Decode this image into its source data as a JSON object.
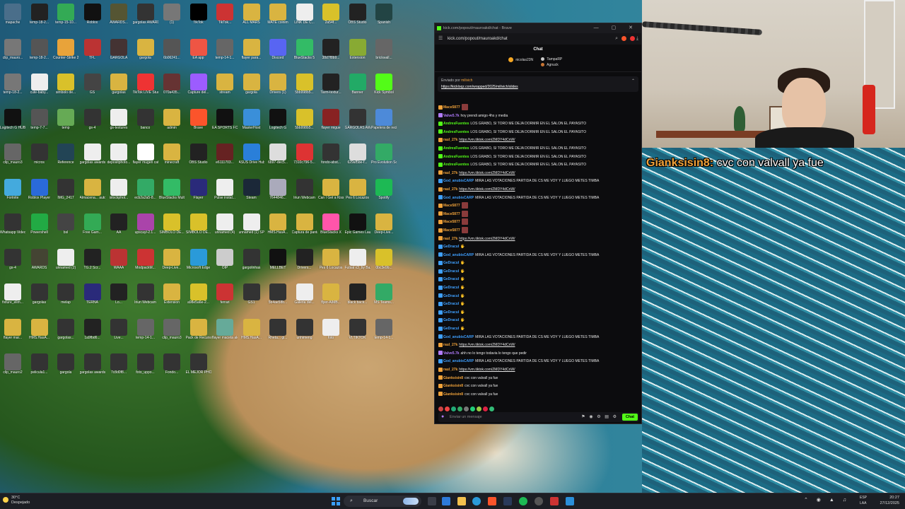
{
  "desktop": {
    "icons": [
      {
        "label": "mapache",
        "color": "#4a6e8a"
      },
      {
        "label": "temp-18-2...",
        "color": "#222"
      },
      {
        "label": "temp-15-10...",
        "color": "#3a5"
      },
      {
        "label": "Roblox",
        "color": "#111"
      },
      {
        "label": "AWARDS...",
        "color": "#553"
      },
      {
        "label": "gargolas AWARDS",
        "color": "#333"
      },
      {
        "label": "(1)",
        "color": "#777"
      },
      {
        "label": "TikTok",
        "color": "#000"
      },
      {
        "label": "TikTok...",
        "color": "#c33"
      },
      {
        "label": "ALL MARS",
        "color": "#d9b441"
      },
      {
        "label": "MATE coinim",
        "color": "#d9b441"
      },
      {
        "label": "LINK DE C...",
        "color": "#eee"
      },
      {
        "label": "2a54f...",
        "color": "#d9c12a"
      },
      {
        "label": "OBS Studio",
        "color": "#222"
      },
      {
        "label": "Spanish",
        "color": "#244"
      },
      {
        "label": "clip_mauro...",
        "color": "#777"
      },
      {
        "label": "temp-18-2...",
        "color": "#555"
      },
      {
        "label": "Counter-Strike 2",
        "color": "#e8a33a"
      },
      {
        "label": "TFL",
        "color": "#b33"
      },
      {
        "label": "GARGOLA",
        "color": "#433"
      },
      {
        "label": "gargola",
        "color": "#d9b441"
      },
      {
        "label": "6b06241...",
        "color": "#555"
      },
      {
        "label": "EA app",
        "color": "#e54"
      },
      {
        "label": "temp-14-1...",
        "color": "#666"
      },
      {
        "label": "flayer para...",
        "color": "#d9b441"
      },
      {
        "label": "Discord",
        "color": "#5865f2"
      },
      {
        "label": "BlueStacks 5",
        "color": "#3b6"
      },
      {
        "label": "38d7f8b9...",
        "color": "#222"
      },
      {
        "label": "Extension",
        "color": "#8a3"
      },
      {
        "label": "brickwall...",
        "color": "#666"
      },
      {
        "label": "temp-18-2...",
        "color": "#777"
      },
      {
        "label": "cute-baby...",
        "color": "#eee"
      },
      {
        "label": "simbolo de...",
        "color": "#d9c12a"
      },
      {
        "label": "GS",
        "color": "#444"
      },
      {
        "label": "gargolas",
        "color": "#d9b441"
      },
      {
        "label": "TikTok LIVE Studio",
        "color": "#e33"
      },
      {
        "label": "070a435...",
        "color": "#633"
      },
      {
        "label": "Capture del...",
        "color": "#9c5cff"
      },
      {
        "label": "stream",
        "color": "#d9b441"
      },
      {
        "label": "gargola",
        "color": "#d9b441"
      },
      {
        "label": "Drivers (1)",
        "color": "#d9b441"
      },
      {
        "label": "5bb998b5...",
        "color": "#d9c12a"
      },
      {
        "label": "Tarm-textur...",
        "color": "#222"
      },
      {
        "label": "Banner",
        "color": "#2a6"
      },
      {
        "label": "Kick Symbol",
        "color": "#53fc18"
      },
      {
        "label": "Logitech G HUB",
        "color": "#111"
      },
      {
        "label": "temp-7-7...",
        "color": "#555"
      },
      {
        "label": "temp",
        "color": "#6a5"
      },
      {
        "label": "gs-4",
        "color": "#333"
      },
      {
        "label": "gs-textures",
        "color": "#eee"
      },
      {
        "label": "banco",
        "color": "#333"
      },
      {
        "label": "admin",
        "color": "#d9b441"
      },
      {
        "label": "Brave",
        "color": "#fb542b"
      },
      {
        "label": "EA SPORTS FC",
        "color": "#111"
      },
      {
        "label": "MasterHost",
        "color": "#3a8fd9"
      },
      {
        "label": "Logitech G",
        "color": "#111"
      },
      {
        "label": "5bb998b5...",
        "color": "#d9c12a"
      },
      {
        "label": "flayer migue",
        "color": "#822"
      },
      {
        "label": "GARGOLAS AWARDS",
        "color": "#333"
      },
      {
        "label": "Papelera de reciclaje",
        "color": "#4d8ad9"
      },
      {
        "label": "clip_mauro3",
        "color": "#666"
      },
      {
        "label": "micros",
        "color": "#333"
      },
      {
        "label": "Reference",
        "color": "#245"
      },
      {
        "label": "gargolas awards",
        "color": "#eee"
      },
      {
        "label": "depositphoto...",
        "color": "#eee"
      },
      {
        "label": "flayer mugen caffera",
        "color": "#fff"
      },
      {
        "label": "minecraft",
        "color": "#d9b441"
      },
      {
        "label": "OBS Studio",
        "color": "#222"
      },
      {
        "label": "e6111703...",
        "color": "#622"
      },
      {
        "label": "ASUS Drive Hub",
        "color": "#2a7fd9"
      },
      {
        "label": "6b97-dec5...",
        "color": "#ddd"
      },
      {
        "label": "7310c796-5...",
        "color": "#d33"
      },
      {
        "label": "fondo-abst...",
        "color": "#333"
      },
      {
        "label": "629af5be-f...",
        "color": "#ddd"
      },
      {
        "label": "Pro Evolution Soccer 6",
        "color": "#3a6"
      },
      {
        "label": "Fortnite",
        "color": "#4ad"
      },
      {
        "label": "Roblox Player",
        "color": "#2a6ad9"
      },
      {
        "label": "IMG_2417",
        "color": "#333"
      },
      {
        "label": "Almacena... automatic...",
        "color": "#d9b441"
      },
      {
        "label": "istockphot...",
        "color": "#eee"
      },
      {
        "label": "ecb2a2a5-8...",
        "color": "#3a6"
      },
      {
        "label": "BlueStacks Multi-Insta...",
        "color": "#3b6"
      },
      {
        "label": "Flayer",
        "color": "#2a2a7a"
      },
      {
        "label": "Pulse instal...",
        "color": "#eee"
      },
      {
        "label": "Steam",
        "color": "#1b2838"
      },
      {
        "label": "7644846...",
        "color": "#aab"
      },
      {
        "label": "Iriun Webcam",
        "color": "#333"
      },
      {
        "label": "Can I Get a Kiss Mauroo",
        "color": "#d9b441"
      },
      {
        "label": "Pes 6 Locazos",
        "color": "#d9b441"
      },
      {
        "label": "Spotify",
        "color": "#1db954"
      },
      {
        "label": "Whatsapp Video 2025",
        "color": "#333"
      },
      {
        "label": "Powershell",
        "color": "#2a4"
      },
      {
        "label": "bsl",
        "color": "#444"
      },
      {
        "label": "Free Gam...",
        "color": "#3a5"
      },
      {
        "label": "AA",
        "color": "#222"
      },
      {
        "label": "upscayl-2.1...",
        "color": "#a4a"
      },
      {
        "label": "SIMBOLO DE...",
        "color": "#d9c12a"
      },
      {
        "label": "SIMBOLO DE...",
        "color": "#d9c12a"
      },
      {
        "label": "unnamed (4)",
        "color": "#eee"
      },
      {
        "label": "unnamed (1) SPOOL...",
        "color": "#eee"
      },
      {
        "label": "HMS.HasA...",
        "color": "#d9b441"
      },
      {
        "label": "Captura de pantalla ...",
        "color": "#d9b441"
      },
      {
        "label": "BlueStacks X",
        "color": "#f5a"
      },
      {
        "label": "Epic Games Launcher",
        "color": "#111"
      },
      {
        "label": "Deep-Live...",
        "color": "#d9b441"
      },
      {
        "label": "gs-4",
        "color": "#333"
      },
      {
        "label": "AWARDS",
        "color": "#443"
      },
      {
        "label": "unnamed (2)",
        "color": "#eee"
      },
      {
        "label": "TG.2 Scr...",
        "color": "#222"
      },
      {
        "label": "WAAA",
        "color": "#b33"
      },
      {
        "label": "ModpackM...",
        "color": "#c33"
      },
      {
        "label": "Deep-Live...",
        "color": "#d9b441"
      },
      {
        "label": "Microsoft Edge",
        "color": "#2a9ad9"
      },
      {
        "label": "OIP",
        "color": "#ccc"
      },
      {
        "label": "gargolinhas",
        "color": "#333"
      },
      {
        "label": "MELLBET",
        "color": "#111"
      },
      {
        "label": "Drivers...",
        "color": "#222"
      },
      {
        "label": "Pes 6 Locazos",
        "color": "#d9b441"
      },
      {
        "label": "Futsal x3_by Bazinga Fro...",
        "color": "#eee"
      },
      {
        "label": "0bc3e9b...",
        "color": "#d9c12a"
      },
      {
        "label": "fixture_elim...",
        "color": "#eee"
      },
      {
        "label": "gargolas",
        "color": "#333"
      },
      {
        "label": "melap",
        "color": "#333"
      },
      {
        "label": "TERNA",
        "color": "#2a2a7a"
      },
      {
        "label": "Lo...",
        "color": "#222"
      },
      {
        "label": "Iriun Webcam",
        "color": "#333"
      },
      {
        "label": "Extension",
        "color": "#d9b441"
      },
      {
        "label": "a98e5a6e-2...",
        "color": "#d9c12a"
      },
      {
        "label": "ferrari",
        "color": "#c33"
      },
      {
        "label": "GS1",
        "color": "#333"
      },
      {
        "label": "5b4ae58b...",
        "color": "#333"
      },
      {
        "label": "Galeria del...",
        "color": "#eee"
      },
      {
        "label": "flyer-AIMB...",
        "color": "#d9b441"
      },
      {
        "label": "black back...",
        "color": "#222"
      },
      {
        "label": "MS Teams...",
        "color": "#3a6"
      },
      {
        "label": "flayer mar...",
        "color": "#d9b441"
      },
      {
        "label": "HMS.HasA...",
        "color": "#d9b441"
      },
      {
        "label": "gargolas...",
        "color": "#333"
      },
      {
        "label": "1a9fbd6...",
        "color": "#222"
      },
      {
        "label": "Live...",
        "color": "#333"
      },
      {
        "label": "temp-14-1...",
        "color": "#666"
      },
      {
        "label": "clip_mauro3",
        "color": "#666"
      },
      {
        "label": "Pack de Recursos",
        "color": "#d9b441"
      },
      {
        "label": "flayer maceta alca canyat v kits maul...",
        "color": "#6a9"
      },
      {
        "label": "HMS.HasA...",
        "color": "#d9b441"
      },
      {
        "label": "Rheta... gi...",
        "color": "#333"
      },
      {
        "label": "unhimeng",
        "color": "#333"
      },
      {
        "label": "foto",
        "color": "#eee"
      },
      {
        "label": "VI.TIKTOK",
        "color": "#333"
      },
      {
        "label": "temp-14-1...",
        "color": "#666"
      },
      {
        "label": "clip_mauro2",
        "color": "#666"
      },
      {
        "label": "pelicula1...",
        "color": "#333"
      },
      {
        "label": "gargola",
        "color": "#333"
      },
      {
        "label": "gargolas awards",
        "color": "#333"
      },
      {
        "label": "7c8d0f8...",
        "color": "#333"
      },
      {
        "label": "foto_uppo...",
        "color": "#333"
      },
      {
        "label": "Fondo...",
        "color": "#333"
      },
      {
        "label": "EL MEJOR PHONE",
        "color": "#333"
      }
    ]
  },
  "browser": {
    "tab_title": "kick.com/popout/mauroakd/chat - Brave",
    "url": "kick.com/popout/mauroakd/chat",
    "window_controls": "— ▢ ✕"
  },
  "chat": {
    "header": "Chat",
    "leaderboard": {
      "first": {
        "name": "nicolas23N",
        "rank": "1",
        "gifts": "1"
      },
      "second": {
        "name": "TampaRP",
        "gifts": "1"
      },
      "third": {
        "name": "Agnuck",
        "gifts": "1"
      }
    },
    "pinned": {
      "sent_by_label": "Enviado por",
      "sent_by_user": "milivich",
      "link": "https://kickloqz.com/wrapped/2025/milivich/slides"
    },
    "messages": [
      {
        "user": "Mace5877",
        "color": "#f0a23a",
        "text": "",
        "emote": true,
        "link": false
      },
      {
        "user": "Valve5.7k",
        "color": "#b27cff",
        "text": "hoy prendi amigo 4hs y media",
        "emote": false,
        "link": false
      },
      {
        "user": "AndresFuentes",
        "color": "#53fc18",
        "text": "LOS GRABO, SI TORO ME DEJA DORMIR EN EL SALON EL PAYASITO",
        "emote": false,
        "link": false
      },
      {
        "user": "AndresFuentes",
        "color": "#53fc18",
        "text": "LOS GRABO, SI TORO ME DEJA DORMIR EN EL SALON EL PAYASITO",
        "emote": false,
        "link": false
      },
      {
        "user": "raul_27k",
        "color": "#f0a23a",
        "text": "https://vm.tiktok.com/ZMDY4dCnW/",
        "emote": false,
        "link": true
      },
      {
        "user": "AndresFuentes",
        "color": "#53fc18",
        "text": "LOS GRABO, SI TORO ME DEJA DORMIR EN EL SALON EL PAYASITO",
        "emote": false,
        "link": false
      },
      {
        "user": "AndresFuentes",
        "color": "#53fc18",
        "text": "LOS GRABO, SI TORO ME DEJA DORMIR EN EL SALON EL PAYASITO",
        "emote": false,
        "link": false
      },
      {
        "user": "AndresFuentes",
        "color": "#53fc18",
        "text": "LOS GRABO, SI TORO ME DEJA DORMIR EN EL SALON EL PAYASITO",
        "emote": false,
        "link": false
      },
      {
        "user": "raul_27k",
        "color": "#f0a23a",
        "text": "https://vm.tiktok.com/ZMDY4dCnW/",
        "emote": false,
        "link": true
      },
      {
        "user": "God_anubisCARP",
        "color": "#3fa0ff",
        "text": "MIRA LAS VOTACIONES PARTIDA DE CS ME VOY Y LUEGO METES TIMBA",
        "emote": false,
        "link": false
      },
      {
        "user": "raul_27k",
        "color": "#f0a23a",
        "text": "https://vm.tiktok.com/ZMDY4dCnW/",
        "emote": false,
        "link": true
      },
      {
        "user": "God_anubisCARP",
        "color": "#3fa0ff",
        "text": "MIRA LAS VOTACIONES PARTIDA DE CS ME VOY Y LUEGO METES TIMBA",
        "emote": false,
        "link": false
      },
      {
        "user": "Mace5877",
        "color": "#f0a23a",
        "text": "",
        "emote": true,
        "link": false
      },
      {
        "user": "Mace5877",
        "color": "#f0a23a",
        "text": "",
        "emote": true,
        "link": false
      },
      {
        "user": "Mace5877",
        "color": "#f0a23a",
        "text": "",
        "emote": true,
        "link": false
      },
      {
        "user": "Mace5877",
        "color": "#f0a23a",
        "text": "",
        "emote": true,
        "link": false
      },
      {
        "user": "raul_27k",
        "color": "#f0a23a",
        "text": "https://vm.tiktok.com/ZMDY4dCnW/",
        "emote": false,
        "link": true
      },
      {
        "user": "GeDracul",
        "color": "#3fa0ff",
        "text": "🖐",
        "emote": false,
        "link": false
      },
      {
        "user": "God_anubisCARP",
        "color": "#3fa0ff",
        "text": "MIRA LAS VOTACIONES PARTIDA DE CS ME VOY Y LUEGO METES TIMBA",
        "emote": false,
        "link": false
      },
      {
        "user": "GeDracul",
        "color": "#3fa0ff",
        "text": "🖐",
        "emote": false,
        "link": false
      },
      {
        "user": "GeDracul",
        "color": "#3fa0ff",
        "text": "🖐",
        "emote": false,
        "link": false
      },
      {
        "user": "GeDracul",
        "color": "#3fa0ff",
        "text": "🖐",
        "emote": false,
        "link": false
      },
      {
        "user": "GeDracul",
        "color": "#3fa0ff",
        "text": "🖐",
        "emote": false,
        "link": false
      },
      {
        "user": "GeDracul",
        "color": "#3fa0ff",
        "text": "🖐",
        "emote": false,
        "link": false
      },
      {
        "user": "GeDracul",
        "color": "#3fa0ff",
        "text": "🖐",
        "emote": false,
        "link": false
      },
      {
        "user": "GeDracul",
        "color": "#3fa0ff",
        "text": "🖐",
        "emote": false,
        "link": false
      },
      {
        "user": "GeDracul",
        "color": "#3fa0ff",
        "text": "🖐",
        "emote": false,
        "link": false
      },
      {
        "user": "GeDracul",
        "color": "#3fa0ff",
        "text": "🖐",
        "emote": false,
        "link": false
      },
      {
        "user": "God_anubisCARP",
        "color": "#3fa0ff",
        "text": "MIRA LAS VOTACIONES PARTIDA DE CS ME VOY Y LUEGO METES TIMBA",
        "emote": false,
        "link": false
      },
      {
        "user": "raul_27k",
        "color": "#f0a23a",
        "text": "https://vm.tiktok.com/ZMDY4dCnW/",
        "emote": false,
        "link": true
      },
      {
        "user": "Valve5.7k",
        "color": "#b27cff",
        "text": "ahh no lo tengo todavia lo tengo que pedir",
        "emote": false,
        "link": false
      },
      {
        "user": "God_anubisCARP",
        "color": "#3fa0ff",
        "text": "MIRA LAS VOTACIONES PARTIDA DE CS ME VOY Y LUEGO METES TIMBA",
        "emote": false,
        "link": false
      },
      {
        "user": "raul_27k",
        "color": "#f0a23a",
        "text": "https://vm.tiktok.com/ZMDY4dCnW/",
        "emote": false,
        "link": true
      },
      {
        "user": "Gianksisin8",
        "color": "#f0a23a",
        "text": "cvc con valvall ya fue",
        "emote": false,
        "link": false
      },
      {
        "user": "Gianksisin8",
        "color": "#f0a23a",
        "text": "cvc con valvall ya fue",
        "emote": false,
        "link": false
      },
      {
        "user": "Gianksisin8",
        "color": "#f0a23a",
        "text": "cvc con valvall ya fue",
        "emote": false,
        "link": false
      }
    ],
    "input_placeholder": "Enviar un mensaje",
    "send_label": "Chat"
  },
  "stream_overlay": {
    "user": "Gianksisin8:",
    "message": "cvc con valvall ya fue"
  },
  "taskbar": {
    "weather_temp": "30°C",
    "weather_text": "Despejado",
    "search_label": "Buscar",
    "lang_top": "ESP",
    "lang_bottom": "LAA",
    "time": "20:27",
    "date": "27/12/2025"
  }
}
